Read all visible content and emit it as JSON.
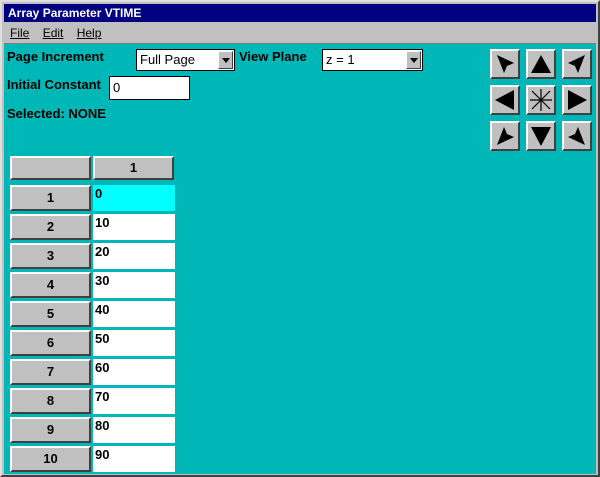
{
  "window": {
    "title": "Array Parameter VTIME"
  },
  "menu": {
    "file": "File",
    "edit": "Edit",
    "help": "Help"
  },
  "controls": {
    "page_increment_label": "Page Increment",
    "page_increment_value": "Full Page",
    "view_plane_label": "View Plane",
    "view_plane_value": "z = 1",
    "initial_constant_label": "Initial Constant",
    "initial_constant_value": "0",
    "selected_text": "Selected: NONE"
  },
  "nav": {
    "icons": [
      "arrow-up-left-icon",
      "arrow-up-icon",
      "arrow-up-right-icon",
      "arrow-left-icon",
      "center-star-icon",
      "arrow-right-icon",
      "arrow-down-left-icon",
      "arrow-down-icon",
      "arrow-down-right-icon"
    ]
  },
  "grid": {
    "column_headers": [
      "1"
    ],
    "row_headers": [
      "1",
      "2",
      "3",
      "4",
      "5",
      "6",
      "7",
      "8",
      "9",
      "10"
    ],
    "values": [
      "0",
      "10",
      "20",
      "30",
      "40",
      "50",
      "60",
      "70",
      "80",
      "90"
    ],
    "selected_cell_color": "#00ffff"
  },
  "colors": {
    "title_bar": "#000080",
    "client_bg": "#00b7b7",
    "face": "#c0c0c0"
  }
}
